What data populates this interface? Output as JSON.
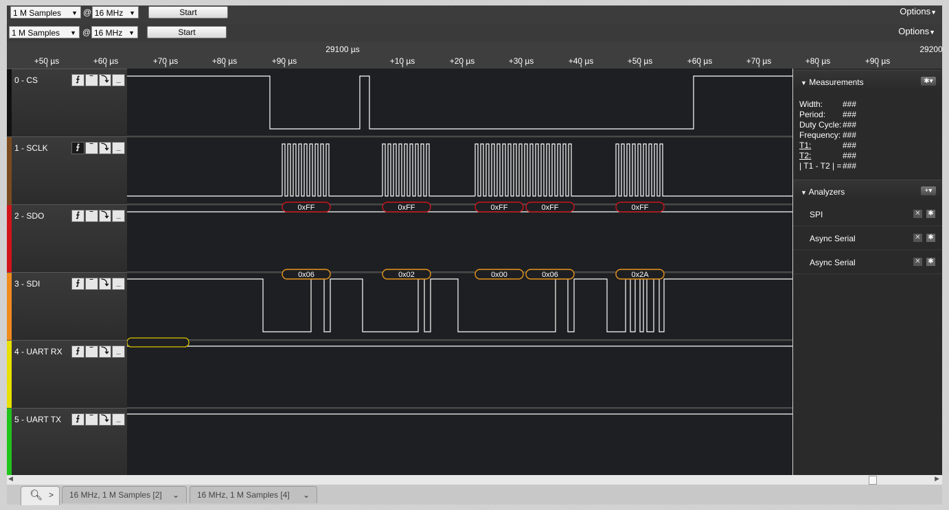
{
  "toolbar1": {
    "samples": "1 M Samples",
    "at": "@",
    "rate": "16 MHz",
    "start": "Start",
    "options": "Options"
  },
  "toolbar2": {
    "samples": "1 M Samples",
    "at": "@",
    "rate": "16 MHz",
    "start": "Start",
    "options": "Options"
  },
  "ruler": {
    "ticks": [
      "+50 µs",
      "+60 µs",
      "+70 µs",
      "+80 µs",
      "+90 µs",
      "+10 µs",
      "+20 µs",
      "+30 µs",
      "+40 µs",
      "+50 µs",
      "+60 µs",
      "+70 µs",
      "+80 µs",
      "+90 µs"
    ],
    "major": [
      "29100 µs",
      "29200"
    ]
  },
  "channels": [
    {
      "name": "0 - CS",
      "color": "#111111"
    },
    {
      "name": "1 - SCLK",
      "color": "#7a4a1e"
    },
    {
      "name": "2 - SDO",
      "color": "#d0141a"
    },
    {
      "name": "3 - SDI",
      "color": "#f08a1c"
    },
    {
      "name": "4 - UART RX",
      "color": "#e8e000"
    },
    {
      "name": "5 - UART TX",
      "color": "#22c21c"
    }
  ],
  "trigger_glyphs": [
    "⨍",
    "‾",
    "⤵",
    "_"
  ],
  "sdo_bytes": [
    "0xFF",
    "0xFF",
    "0xFF",
    "0xFF",
    "0xFF"
  ],
  "sdi_bytes": [
    "0x06",
    "0x02",
    "0x00",
    "0x06",
    "0x2A"
  ],
  "panel": {
    "measurements": {
      "title": "Measurements",
      "rows": [
        {
          "label": "Width:",
          "value": "###"
        },
        {
          "label": "Period:",
          "value": "###"
        },
        {
          "label": "Duty Cycle:",
          "value": "###"
        },
        {
          "label": "Frequency:",
          "value": "###"
        },
        {
          "label": "T1:",
          "value": "###"
        },
        {
          "label": "T2:",
          "value": "###"
        },
        {
          "label": "| T1 - T2 | =",
          "value": "###"
        }
      ]
    },
    "analyzers": {
      "title": "Analyzers",
      "items": [
        "SPI",
        "Async Serial",
        "Async Serial"
      ]
    }
  },
  "tabs": [
    "16 MHz, 1 M Samples [2]",
    "16 MHz, 1 M Samples [4]"
  ]
}
